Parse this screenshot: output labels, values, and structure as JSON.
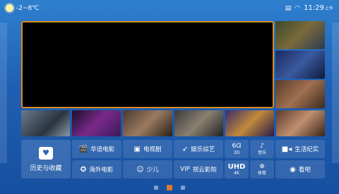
{
  "statusbar": {
    "weather_icon": "sun-icon",
    "temperature": "-2~8℃",
    "icons": [
      "screen-icon",
      "wifi-icon"
    ],
    "time": "11:29",
    "ampm": "上午"
  },
  "player": {
    "state": "black-video"
  },
  "thumbnails": {
    "side_count": 3,
    "row_count": 6
  },
  "menu": {
    "history": {
      "icon": "tv-heart-icon",
      "label": "历史与收藏"
    },
    "row1": [
      {
        "icon": "clapper-icon",
        "label": "华语电影"
      },
      {
        "icon": "tv-icon",
        "label": "电视剧"
      },
      {
        "icon": "rocket-icon",
        "label": "娱乐综艺"
      },
      {
        "icon": "3d-glasses-icon",
        "glyph": "6Ɑ",
        "label": "3D"
      },
      {
        "icon": "music-note-icon",
        "label": "音乐"
      },
      {
        "icon": "camera-icon",
        "label": "生活纪实"
      }
    ],
    "row2": [
      {
        "icon": "film-reel-icon",
        "label": "海外电影"
      },
      {
        "icon": "smile-icon",
        "label": "少儿"
      },
      {
        "icon": "vip-icon",
        "glyph": "VIP",
        "label": "视云影院"
      },
      {
        "icon": "uhd-icon",
        "glyph": "UHD",
        "label": "4K"
      },
      {
        "icon": "basketball-icon",
        "label": "体育"
      },
      {
        "icon": "eye-icon",
        "label": "看吧"
      }
    ]
  },
  "pager": {
    "pages": 3,
    "active": 2
  },
  "colors": {
    "accent": "#d98b1f",
    "background_top": "#2f7fcf",
    "background_bottom": "#164f9f"
  }
}
